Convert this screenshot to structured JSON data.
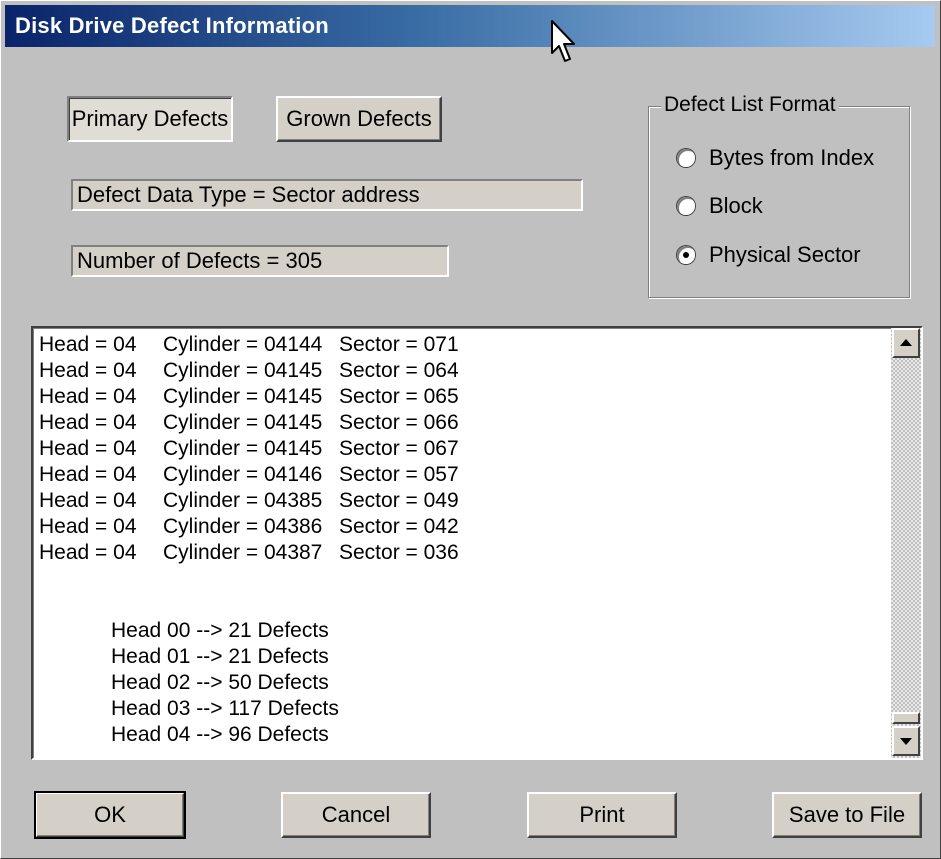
{
  "window": {
    "title": "Disk Drive Defect Information"
  },
  "buttons": {
    "primary": "Primary Defects",
    "grown": "Grown Defects",
    "ok": "OK",
    "cancel": "Cancel",
    "print": "Print",
    "save": "Save to File"
  },
  "info": {
    "data_type": "Defect Data Type = Sector address",
    "count": "Number of Defects = 305"
  },
  "format_group": {
    "legend": "Defect List Format",
    "options": [
      {
        "label": "Bytes from Index",
        "checked": false
      },
      {
        "label": "Block",
        "checked": false
      },
      {
        "label": "Physical Sector",
        "checked": true
      }
    ]
  },
  "defects": [
    {
      "head": "Head = 04",
      "cylinder": "Cylinder = 04144",
      "sector": "Sector = 071"
    },
    {
      "head": "Head = 04",
      "cylinder": "Cylinder = 04145",
      "sector": "Sector = 064"
    },
    {
      "head": "Head = 04",
      "cylinder": "Cylinder = 04145",
      "sector": "Sector = 065"
    },
    {
      "head": "Head = 04",
      "cylinder": "Cylinder = 04145",
      "sector": "Sector = 066"
    },
    {
      "head": "Head = 04",
      "cylinder": "Cylinder = 04145",
      "sector": "Sector = 067"
    },
    {
      "head": "Head = 04",
      "cylinder": "Cylinder = 04146",
      "sector": "Sector = 057"
    },
    {
      "head": "Head = 04",
      "cylinder": "Cylinder = 04385",
      "sector": "Sector = 049"
    },
    {
      "head": "Head = 04",
      "cylinder": "Cylinder = 04386",
      "sector": "Sector = 042"
    },
    {
      "head": "Head = 04",
      "cylinder": "Cylinder = 04387",
      "sector": "Sector = 036"
    }
  ],
  "summary": [
    "Head 00 --> 21 Defects",
    "Head 01 --> 21 Defects",
    "Head 02 --> 50 Defects",
    "Head 03 --> 117 Defects",
    "Head 04 --> 96 Defects"
  ],
  "icons": {
    "cursor": "mouse-pointer-icon",
    "scroll_up": "arrow-up-icon",
    "scroll_down": "arrow-down-icon"
  }
}
